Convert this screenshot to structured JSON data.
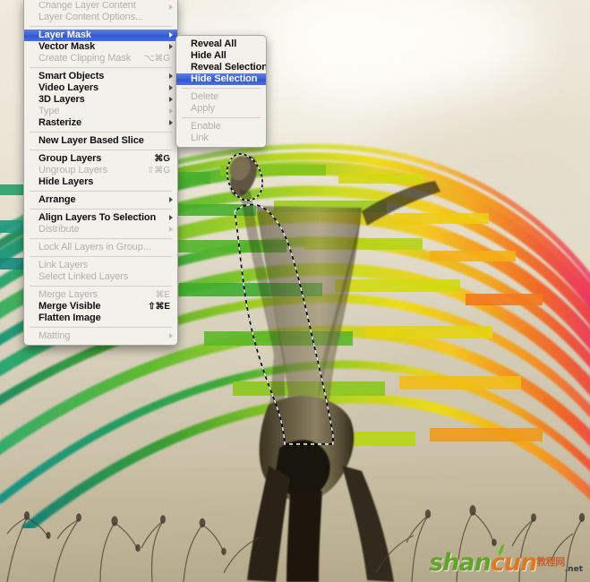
{
  "app": {
    "name": "Adobe Photoshop",
    "context": "Layer menu open over a photo canvas"
  },
  "menus": {
    "main": {
      "name": "Layer menu",
      "items": [
        {
          "label": "Change Layer Content",
          "shortcut": "",
          "state": "disabled",
          "submenu": true,
          "clipped": true
        },
        {
          "label": "Layer Content Options...",
          "shortcut": "",
          "state": "disabled",
          "submenu": false
        },
        {
          "separator": true
        },
        {
          "label": "Layer Mask",
          "shortcut": "",
          "state": "selected",
          "submenu": true
        },
        {
          "label": "Vector Mask",
          "shortcut": "",
          "state": "enabled",
          "submenu": true
        },
        {
          "label": "Create Clipping Mask",
          "shortcut": "⌥⌘G",
          "state": "disabled",
          "submenu": false
        },
        {
          "separator": true
        },
        {
          "label": "Smart Objects",
          "shortcut": "",
          "state": "enabled",
          "submenu": true
        },
        {
          "label": "Video Layers",
          "shortcut": "",
          "state": "enabled",
          "submenu": true
        },
        {
          "label": "3D Layers",
          "shortcut": "",
          "state": "enabled",
          "submenu": true
        },
        {
          "label": "Type",
          "shortcut": "",
          "state": "disabled",
          "submenu": true
        },
        {
          "label": "Rasterize",
          "shortcut": "",
          "state": "enabled",
          "submenu": true
        },
        {
          "separator": true
        },
        {
          "label": "New Layer Based Slice",
          "shortcut": "",
          "state": "enabled",
          "submenu": false
        },
        {
          "separator": true
        },
        {
          "label": "Group Layers",
          "shortcut": "⌘G",
          "state": "enabled",
          "submenu": false
        },
        {
          "label": "Ungroup Layers",
          "shortcut": "⇧⌘G",
          "state": "disabled",
          "submenu": false
        },
        {
          "label": "Hide Layers",
          "shortcut": "",
          "state": "enabled",
          "submenu": false
        },
        {
          "separator": true
        },
        {
          "label": "Arrange",
          "shortcut": "",
          "state": "enabled",
          "submenu": true
        },
        {
          "separator": true
        },
        {
          "label": "Align Layers To Selection",
          "shortcut": "",
          "state": "enabled",
          "submenu": true
        },
        {
          "label": "Distribute",
          "shortcut": "",
          "state": "disabled",
          "submenu": true
        },
        {
          "separator": true
        },
        {
          "label": "Lock All Layers in Group...",
          "shortcut": "",
          "state": "disabled",
          "submenu": false
        },
        {
          "separator": true
        },
        {
          "label": "Link Layers",
          "shortcut": "",
          "state": "disabled",
          "submenu": false
        },
        {
          "label": "Select Linked Layers",
          "shortcut": "",
          "state": "disabled",
          "submenu": false
        },
        {
          "separator": true
        },
        {
          "label": "Merge Layers",
          "shortcut": "⌘E",
          "state": "disabled",
          "submenu": false
        },
        {
          "label": "Merge Visible",
          "shortcut": "⇧⌘E",
          "state": "enabled",
          "submenu": false
        },
        {
          "label": "Flatten Image",
          "shortcut": "",
          "state": "enabled",
          "submenu": false
        },
        {
          "separator": true
        },
        {
          "label": "Matting",
          "shortcut": "",
          "state": "disabled",
          "submenu": true
        }
      ]
    },
    "submenu": {
      "name": "Layer Mask submenu",
      "items": [
        {
          "label": "Reveal All",
          "state": "enabled"
        },
        {
          "label": "Hide All",
          "state": "enabled"
        },
        {
          "label": "Reveal Selection",
          "state": "enabled"
        },
        {
          "label": "Hide Selection",
          "state": "selected"
        },
        {
          "separator": true
        },
        {
          "label": "Delete",
          "state": "disabled"
        },
        {
          "label": "Apply",
          "state": "disabled"
        },
        {
          "separator": true
        },
        {
          "label": "Enable",
          "state": "disabled"
        },
        {
          "label": "Link",
          "state": "disabled"
        }
      ]
    }
  },
  "canvas": {
    "name": "document-canvas",
    "description": "Sepia photograph of a person doing a handstand in a field of dry weeds under a hazy sky, overlaid with rainbow ribbon streaks",
    "selection": "marching-ants selection outlining the person's torso and legs"
  },
  "watermark": {
    "word1": "shan",
    "word2": "cun",
    "chinese": "教程网",
    "tld": ".net",
    "color1": "#64a32b",
    "color2": "#e07a20"
  },
  "colors": {
    "menu_bg": "#f2f1ec",
    "menu_highlight": "#3a60d6",
    "menu_text": "#101010",
    "menu_disabled": "#b3b1ab",
    "sky": "#e9e3d3",
    "ground": "#b3a789",
    "ribbon_teal": "#1f9e86",
    "ribbon_green": "#3fa832",
    "ribbon_lime": "#a8d317",
    "ribbon_yellow": "#f1d310",
    "ribbon_orange": "#f07a16",
    "ribbon_red": "#ec2b4a",
    "ribbon_magenta": "#f0197e"
  }
}
